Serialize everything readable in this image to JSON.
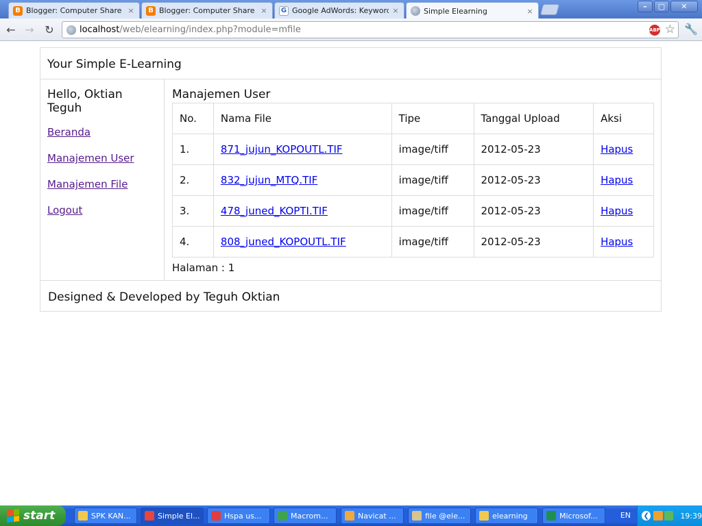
{
  "browser": {
    "tabs": [
      {
        "title": "Blogger: Computer Share - All",
        "icon": "blogger-icon"
      },
      {
        "title": "Blogger: Computer Share - Cre",
        "icon": "blogger-icon"
      },
      {
        "title": "Google AdWords: Keyword Too",
        "icon": "google-icon"
      },
      {
        "title": "Simple Elearning",
        "icon": "globe-icon",
        "active": true
      }
    ],
    "tab_close": "×",
    "url_host": "localhost",
    "url_path": "/web/elearning/index.php?module=mfile",
    "abp_label": "ABP",
    "window_buttons": {
      "minimize": "–",
      "maximize": "▢",
      "close": "✕"
    }
  },
  "site": {
    "header_title": "Your Simple E-Learning",
    "greeting": "Hello, Oktian Teguh",
    "nav": [
      "Beranda",
      "Manajemen User",
      "Manajemen File",
      "Logout"
    ],
    "section_title": "Manajemen User",
    "table": {
      "headers": [
        "No.",
        "Nama File",
        "Tipe",
        "Tanggal Upload",
        "Aksi"
      ],
      "rows": [
        {
          "no": "1.",
          "name": "871_jujun_KOPOUTL.TIF",
          "type": "image/tiff",
          "date": "2012-05-23",
          "action": "Hapus"
        },
        {
          "no": "2.",
          "name": "832_jujun_MTQ.TIF",
          "type": "image/tiff",
          "date": "2012-05-23",
          "action": "Hapus"
        },
        {
          "no": "3.",
          "name": "478_juned_KOPTI.TIF",
          "type": "image/tiff",
          "date": "2012-05-23",
          "action": "Hapus"
        },
        {
          "no": "4.",
          "name": "808_juned_KOPOUTL.TIF",
          "type": "image/tiff",
          "date": "2012-05-23",
          "action": "Hapus"
        }
      ]
    },
    "pager": "Halaman : 1",
    "footer": "Designed & Developed by Teguh Oktian"
  },
  "taskbar": {
    "start_label": "start",
    "tasks": [
      {
        "label": "SPK KAN...",
        "color": "#f2c94c"
      },
      {
        "label": "Simple El...",
        "color": "#e8453c",
        "active": true
      },
      {
        "label": "Hspa us...",
        "color": "#e23c3c"
      },
      {
        "label": "Macrom...",
        "color": "#3fa34d"
      },
      {
        "label": "Navicat ...",
        "color": "#f2a93b"
      },
      {
        "label": "file @ele...",
        "color": "#d9c48f"
      },
      {
        "label": "elearning",
        "color": "#f2c94c"
      },
      {
        "label": "Microsof...",
        "color": "#1f8f4e"
      }
    ],
    "lang": "EN",
    "clock": "19:39"
  }
}
